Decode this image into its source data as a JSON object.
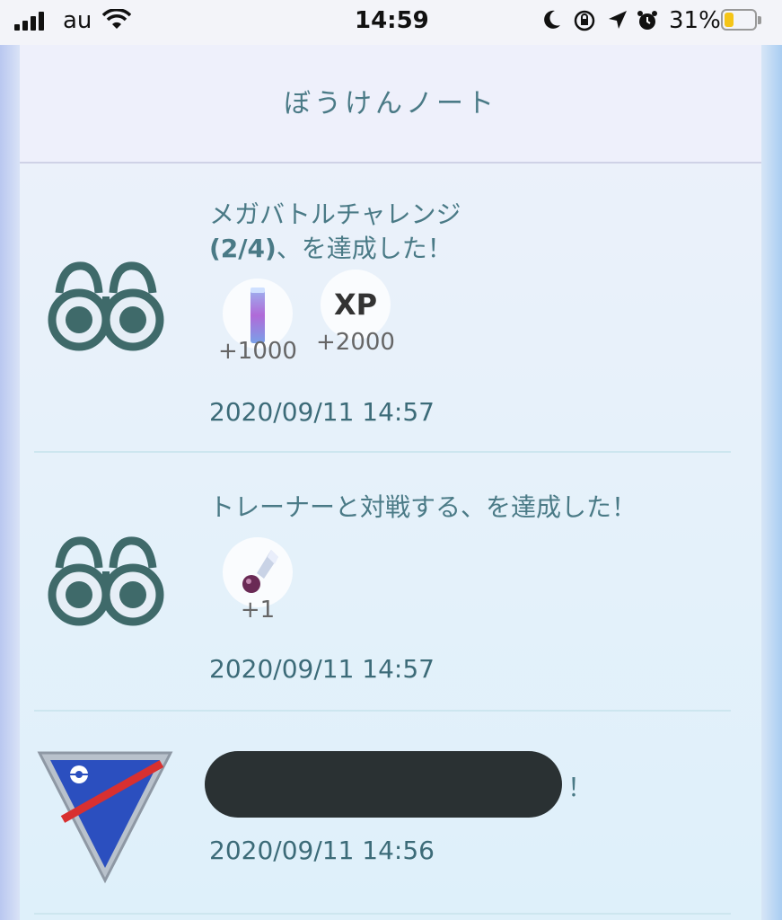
{
  "status_bar": {
    "carrier": "au",
    "time": "14:59",
    "battery": "31%"
  },
  "header": {
    "title": "ぼうけんノート"
  },
  "entries": [
    {
      "icon": "binoculars-icon",
      "title_line1": "メガバトルチャレンジ",
      "title_bold": "(2/4)",
      "title_line2_rest": "、を達成した！",
      "rewards": [
        {
          "icon": "stardust-icon",
          "value": "+1000"
        },
        {
          "icon": "xp-icon",
          "label": "XP",
          "value": "+2000"
        }
      ],
      "timestamp": "2020/09/11 14:57"
    },
    {
      "icon": "binoculars-icon",
      "title": "トレーナーと対戦する、を達成した！",
      "rewards": [
        {
          "icon": "sinnoh-stone-icon",
          "value": "+1"
        }
      ],
      "timestamp": "2020/09/11 14:57"
    },
    {
      "icon": "great-league-icon",
      "title_suffix": "！",
      "timestamp": "2020/09/11 14:56"
    }
  ],
  "colors": {
    "text_teal": "#4a7a86",
    "icon_dark": "#3f6a6a",
    "league_blue": "#2b4fbf",
    "league_red": "#d83030"
  }
}
